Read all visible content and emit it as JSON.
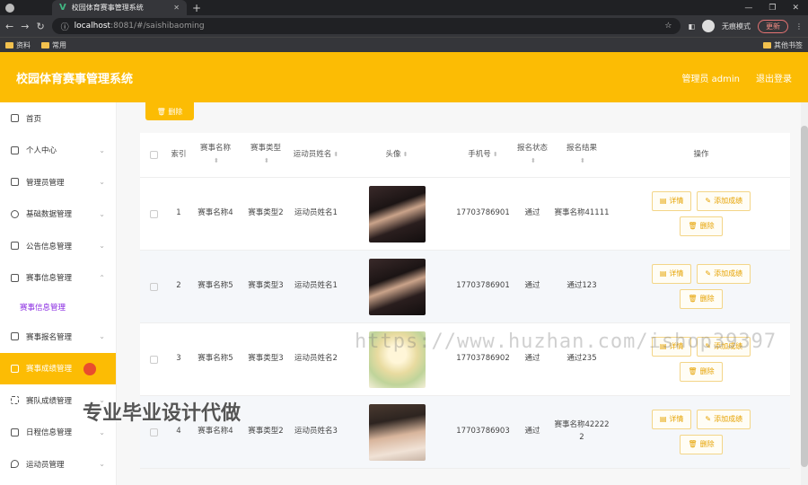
{
  "browser": {
    "tab_title": "校园体育赛事管理系统",
    "url_host": "localhost",
    "url_rest": ":8081/#/saishibaoming",
    "profile_label": "无痕模式",
    "update_label": "更新",
    "bookmarks": [
      "资料",
      "常用"
    ],
    "other_bookmarks": "其他书签"
  },
  "header": {
    "title": "校园体育赛事管理系统",
    "user": "管理员 admin",
    "logout": "退出登录"
  },
  "sidebar": {
    "items": [
      {
        "label": "首页",
        "icon": "home-icon"
      },
      {
        "label": "个人中心",
        "icon": "user-icon"
      },
      {
        "label": "管理员管理",
        "icon": "flag-icon"
      },
      {
        "label": "基础数据管理",
        "icon": "globe-icon"
      },
      {
        "label": "公告信息管理",
        "icon": "send-icon"
      },
      {
        "label": "赛事信息管理",
        "icon": "sliders-icon"
      },
      {
        "label": "赛事信息管理",
        "icon": "",
        "sub": true
      },
      {
        "label": "赛事报名管理",
        "icon": "monitor-icon"
      },
      {
        "label": "赛事成绩管理",
        "icon": "monitor-icon",
        "active": true
      },
      {
        "label": "赛队成绩管理",
        "icon": "scan-icon"
      },
      {
        "label": "日程信息管理",
        "icon": "phone-icon"
      },
      {
        "label": "运动员管理",
        "icon": "pin-icon"
      }
    ]
  },
  "toolbar": {
    "delete_label": "删除"
  },
  "table": {
    "headers": {
      "index": "索引",
      "name": "赛事名称",
      "type": "赛事类型",
      "athlete": "运动员姓名",
      "avatar": "头像",
      "phone": "手机号",
      "status": "报名状态",
      "result": "报名结果",
      "ops": "操作"
    },
    "rows": [
      {
        "index": "1",
        "name": "赛事名称4",
        "type": "赛事类型2",
        "athlete": "运动员姓名1",
        "phone": "17703786901",
        "status": "通过",
        "result": "赛事名称41111"
      },
      {
        "index": "2",
        "name": "赛事名称5",
        "type": "赛事类型3",
        "athlete": "运动员姓名1",
        "phone": "17703786901",
        "status": "通过",
        "result": "通过123"
      },
      {
        "index": "3",
        "name": "赛事名称5",
        "type": "赛事类型3",
        "athlete": "运动员姓名2",
        "phone": "17703786902",
        "status": "通过",
        "result": "通过235"
      },
      {
        "index": "4",
        "name": "赛事名称4",
        "type": "赛事类型2",
        "athlete": "运动员姓名3",
        "phone": "17703786903",
        "status": "通过",
        "result": "赛事名称422222"
      }
    ],
    "ops": {
      "detail": "详情",
      "add_score": "添加成绩",
      "delete": "删除"
    }
  },
  "overlay": {
    "watermark": "https://www.huzhan.com/ishop39397",
    "promo": "专业毕业设计代做"
  }
}
